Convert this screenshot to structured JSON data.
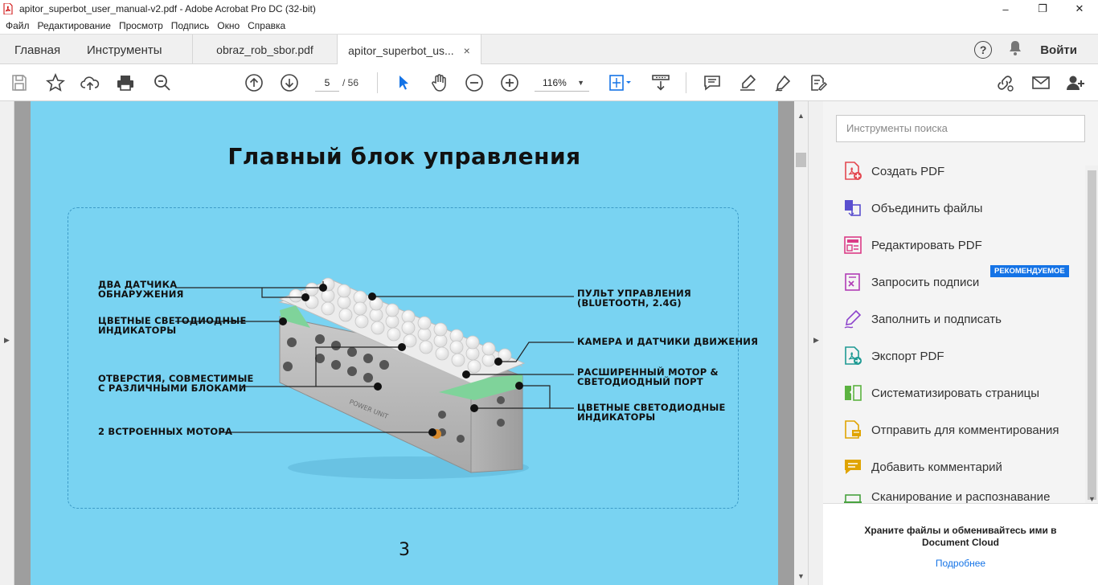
{
  "window": {
    "title": "apitor_superbot_user_manual-v2.pdf - Adobe Acrobat Pro DC (32-bit)",
    "controls": {
      "minimize": "–",
      "maximize": "❐",
      "close": "✕"
    }
  },
  "menu": [
    "Файл",
    "Редактирование",
    "Просмотр",
    "Подпись",
    "Окно",
    "Справка"
  ],
  "tabs": {
    "home": "Главная",
    "tools": "Инструменты",
    "doc1": "obraz_rob_sbor.pdf",
    "doc2": "apitor_superbot_us...",
    "doc2_close": "×",
    "help": "?",
    "signin": "Войти"
  },
  "toolbar": {
    "page_current": "5",
    "page_total": "/ 56",
    "zoom": "116%",
    "zoom_caret": "▼"
  },
  "document": {
    "title": "Главный блок управления",
    "page_number": "3",
    "labels": {
      "two_sensors": "Два датчика\nобнаружения",
      "color_leds_left": "Цветные светодиодные\nиндикаторы",
      "holes": "Отверстия, совместимые\nс различными блоками",
      "motors": "2 встроенных мотора",
      "remote": "Пульт управления\n(Bluetooth, 2.4G)",
      "camera": "Камера и датчики движения",
      "ext_motor": "Расширенный мотор &\nСветодиодный  порт",
      "color_leds_right": "Цветные светодиодные\nиндикаторы"
    },
    "device_text": "POWER UNIT"
  },
  "panel": {
    "search_placeholder": "Инструменты поиска",
    "badge": "РЕКОМЕНДУЕМОЕ",
    "tools": [
      {
        "label": "Создать PDF",
        "icon": "create-pdf-icon",
        "color": "#e34850"
      },
      {
        "label": "Объединить файлы",
        "icon": "combine-files-icon",
        "color": "#5a4fcf"
      },
      {
        "label": "Редактировать PDF",
        "icon": "edit-pdf-icon",
        "color": "#da3b86"
      },
      {
        "label": "Запросить подписи",
        "icon": "request-signatures-icon",
        "color": "#b03cb6"
      },
      {
        "label": "Заполнить и подписать",
        "icon": "fill-sign-icon",
        "color": "#8d44cc"
      },
      {
        "label": "Экспорт PDF",
        "icon": "export-pdf-icon",
        "color": "#1e9a93"
      },
      {
        "label": "Систематизировать страницы",
        "icon": "organize-pages-icon",
        "color": "#5bb240"
      },
      {
        "label": "Отправить для комментирования",
        "icon": "send-comment-icon",
        "color": "#e0a400"
      },
      {
        "label": "Добавить комментарий",
        "icon": "comment-icon",
        "color": "#e0a400"
      },
      {
        "label": "Сканирование и распознавание",
        "icon": "scan-ocr-icon",
        "color": "#48a23f"
      }
    ],
    "promo_text": "Храните файлы и обменивайтесь ими в Document Cloud",
    "promo_link": "Подробнее"
  }
}
